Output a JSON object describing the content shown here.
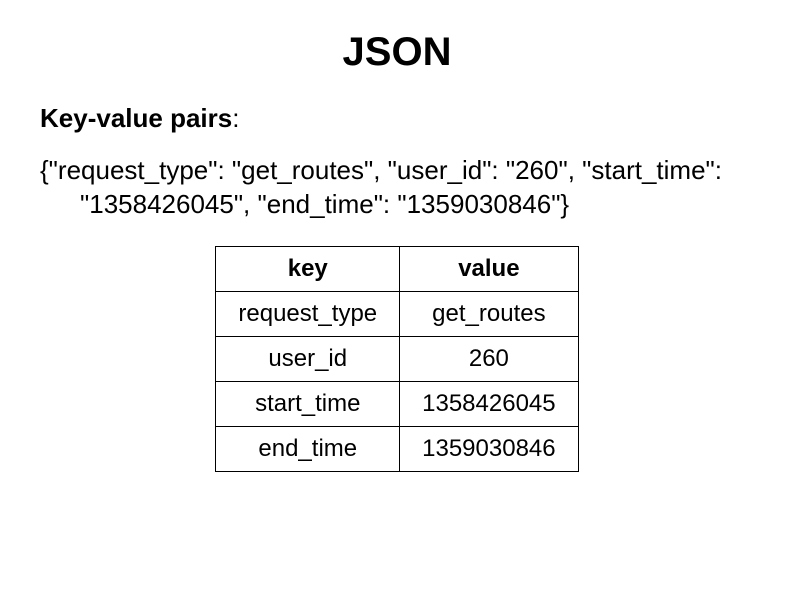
{
  "title": "JSON",
  "subtitle_bold": "Key-value pairs",
  "subtitle_suffix": ":",
  "json_text": "{\"request_type\": \"get_routes\", \"user_id\": \"260\", \"start_time\": \"1358426045\", \"end_time\": \"1359030846\"}",
  "table": {
    "headers": {
      "key": "key",
      "value": "value"
    },
    "rows": [
      {
        "key": "request_type",
        "value": "get_routes"
      },
      {
        "key": "user_id",
        "value": "260"
      },
      {
        "key": "start_time",
        "value": "1358426045"
      },
      {
        "key": "end_time",
        "value": "1359030846"
      }
    ]
  }
}
